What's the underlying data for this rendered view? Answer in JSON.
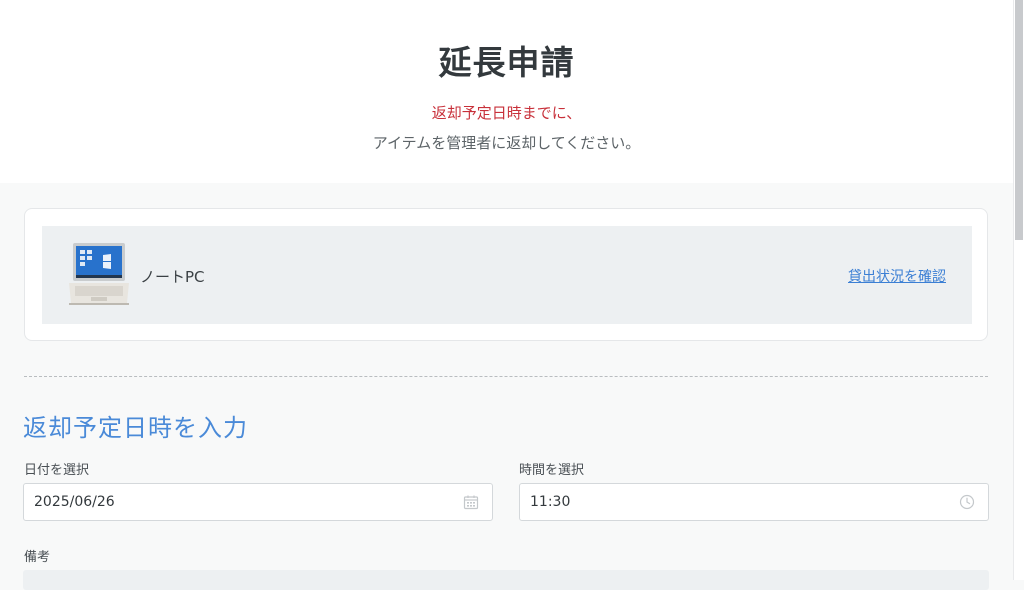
{
  "header": {
    "title": "延長申請",
    "notice_warning": "返却予定日時までに、",
    "notice_text": "アイテムを管理者に返却してください。"
  },
  "item": {
    "name": "ノートPC",
    "status_link": "貸出状況を確認",
    "thumbnail_icon": "laptop-image"
  },
  "form": {
    "section_title": "返却予定日時を入力",
    "date": {
      "label": "日付を選択",
      "value": "2025/06/26",
      "icon": "calendar-icon"
    },
    "time": {
      "label": "時間を選択",
      "value": "11:30",
      "icon": "clock-icon"
    },
    "remarks": {
      "label": "備考"
    }
  },
  "colors": {
    "warning": "#c8303a",
    "accent": "#4a8ad8",
    "link": "#3b7fd4"
  }
}
